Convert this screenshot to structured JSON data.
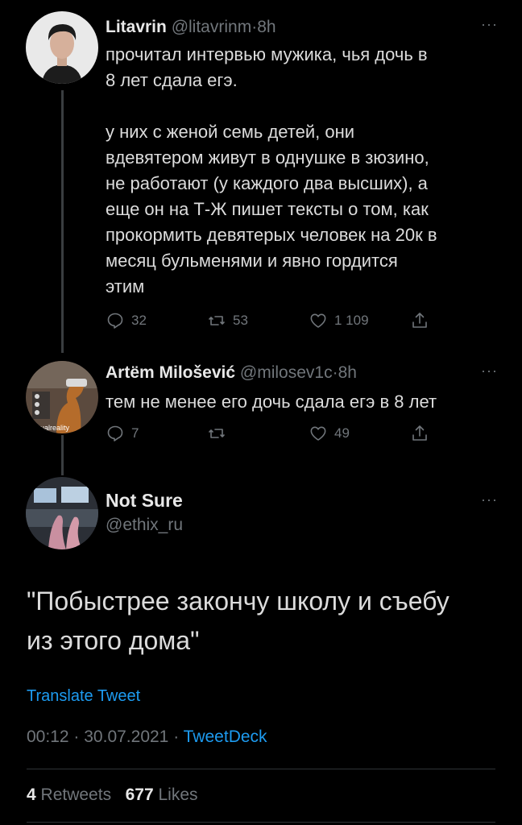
{
  "colors": {
    "background": "#000000",
    "accent": "#1d9bf0",
    "muted": "#71767b",
    "text": "#dcdcdc"
  },
  "tweets": [
    {
      "name": "Litavrin",
      "handle": "@litavrinm",
      "dot": "·",
      "time": "8h",
      "more": "···",
      "text": "прочитал интервью мужика, чья дочь в\n8 лет сдала егэ.\n\nу них с женой семь детей, они\nвдевятером живут в однушке в зюзино,\nне работают (у каждого два высших), а\nеще он на Т-Ж пишет тексты о том, как\nпрокормить девятерых человек на 20к в\nмесяц бульменями и явно гордится\nэтим",
      "replies": "32",
      "retweets": "53",
      "likes": "1 109"
    },
    {
      "name": "Artëm Milošević",
      "handle": "@milosev1c",
      "dot": "·",
      "time": "8h",
      "more": "···",
      "text": "тем не менее его дочь сдала егэ в 8 лет",
      "replies": "7",
      "retweets": "",
      "likes": "49",
      "avatar_caption": "virtualreality"
    }
  ],
  "main_tweet": {
    "name": "Not Sure",
    "handle": "@ethix_ru",
    "more": "···",
    "text": "\"Побыстрее закончу школу и съебу\nиз этого дома\"",
    "translate": "Translate Tweet",
    "time": "00:12",
    "sep": "·",
    "date": "30.07.2021",
    "source": "TweetDeck",
    "retweets_count": "4",
    "retweets_label": "Retweets",
    "likes_count": "677",
    "likes_label": "Likes"
  }
}
